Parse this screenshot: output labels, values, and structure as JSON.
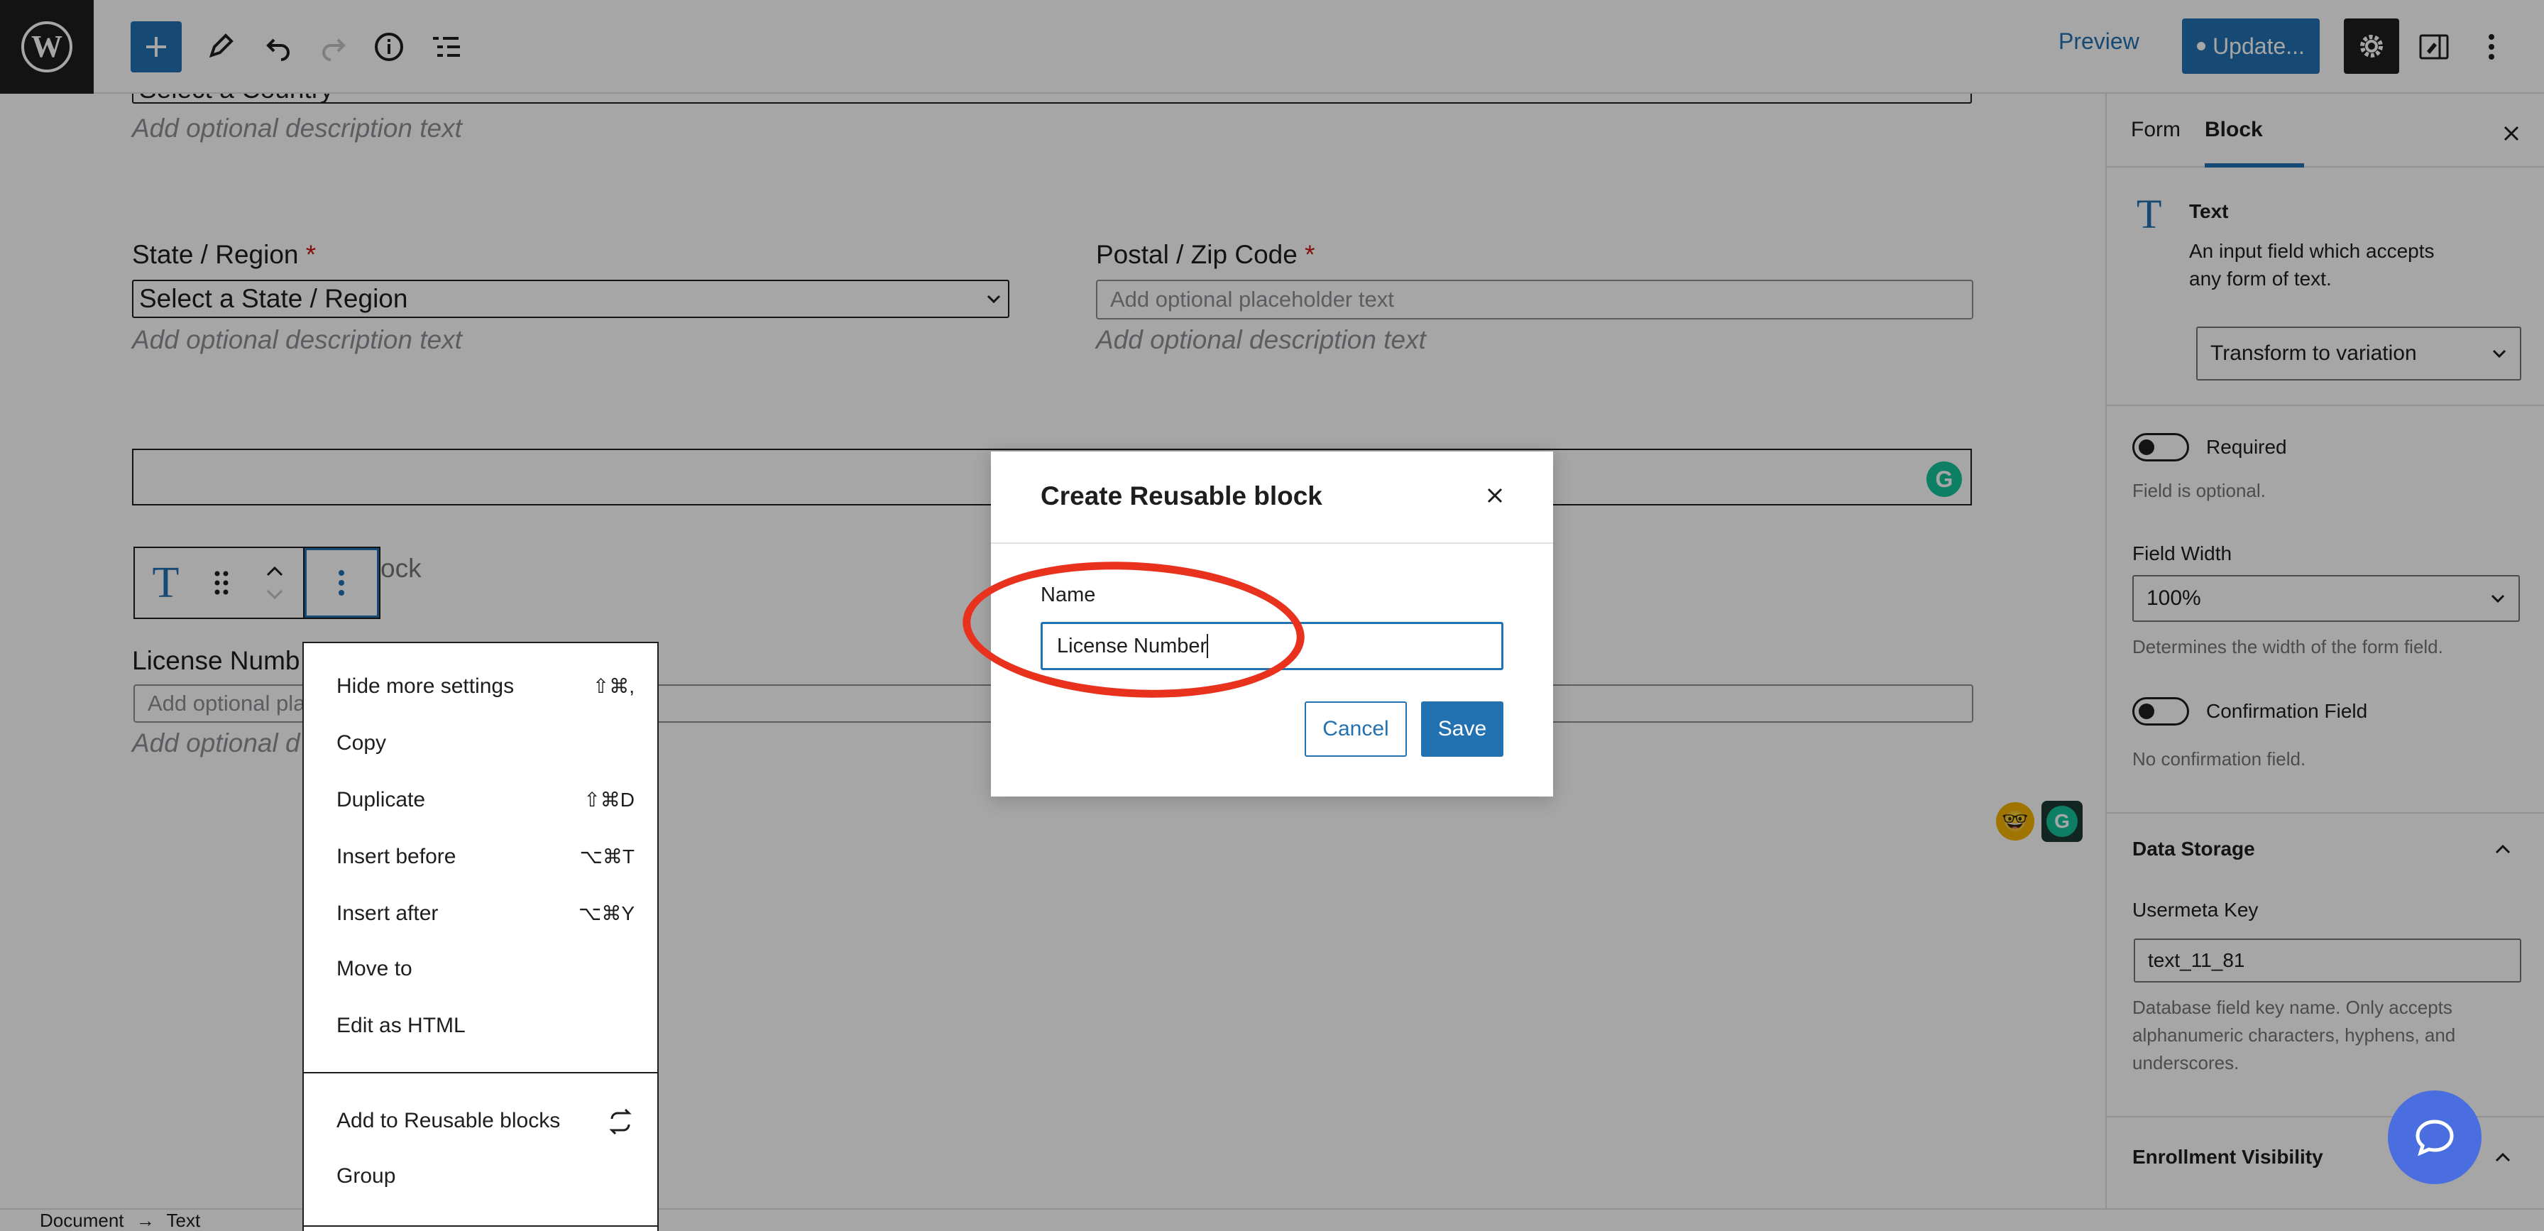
{
  "topbar": {
    "preview_label": "Preview",
    "update_label": "Update..."
  },
  "editor": {
    "country_select_value": "Select a Country",
    "country_description": "Add optional description text",
    "state_label": "State / Region",
    "state_select_value": "Select a State / Region",
    "state_description": "Add optional description text",
    "postal_label": "Postal / Zip Code",
    "postal_placeholder": "Add optional placeholder text",
    "postal_description": "Add optional description text",
    "block_hint_partial": "ock",
    "license_label_partial": "License Numb",
    "license_placeholder_partial": "Add optional pla",
    "license_description_partial": "Add optional d",
    "required_mark": "*"
  },
  "block_menu": {
    "items": [
      {
        "label": "Hide more settings",
        "shortcut": "⇧⌘,"
      },
      {
        "label": "Copy",
        "shortcut": ""
      },
      {
        "label": "Duplicate",
        "shortcut": "⇧⌘D"
      },
      {
        "label": "Insert before",
        "shortcut": "⌥⌘T"
      },
      {
        "label": "Insert after",
        "shortcut": "⌥⌘Y"
      },
      {
        "label": "Move to",
        "shortcut": ""
      },
      {
        "label": "Edit as HTML",
        "shortcut": ""
      },
      {
        "label": "Add to Reusable blocks",
        "shortcut": ""
      },
      {
        "label": "Group",
        "shortcut": ""
      }
    ]
  },
  "modal": {
    "title": "Create Reusable block",
    "name_label": "Name",
    "name_value": "License Number",
    "cancel_label": "Cancel",
    "save_label": "Save"
  },
  "sidebar": {
    "tabs": [
      "Form",
      "Block"
    ],
    "block_name": "Text",
    "block_description": "An input field which accepts any form of text.",
    "transform_label": "Transform to variation",
    "required_label": "Required",
    "required_help": "Field is optional.",
    "field_width_label": "Field Width",
    "field_width_value": "100%",
    "field_width_help": "Determines the width of the form field.",
    "confirmation_label": "Confirmation Field",
    "confirmation_help": "No confirmation field.",
    "data_storage_title": "Data Storage",
    "usermeta_label": "Usermeta Key",
    "usermeta_value": "text_11_81",
    "usermeta_help": "Database field key name. Only accepts alphanumeric characters, hyphens, and underscores.",
    "enrollment_title": "Enrollment Visibility"
  },
  "footer": {
    "breadcrumb_document": "Document",
    "breadcrumb_arrow": "→",
    "breadcrumb_block": "Text"
  },
  "colors": {
    "accent": "#2271b1",
    "annotation": "#e8321e",
    "grammarly": "#15c39a"
  }
}
